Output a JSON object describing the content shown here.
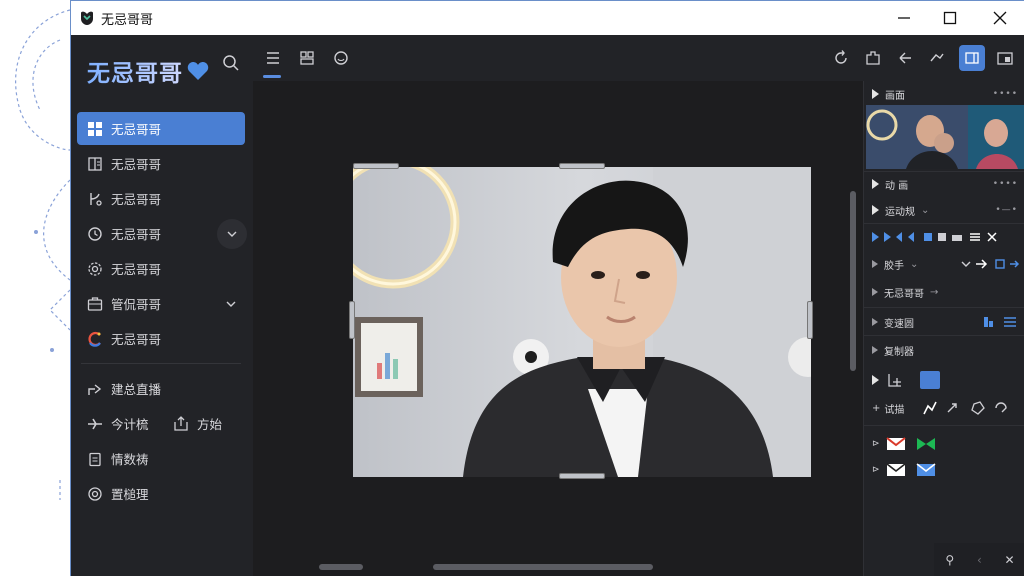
{
  "window": {
    "title": "无忌哥哥",
    "controls": {
      "minimize": "minimize",
      "maximize": "maximize",
      "close": "close"
    }
  },
  "sidebar": {
    "brand": "无忌哥哥",
    "items": [
      {
        "label": "无忌哥哥",
        "icon": "grid-icon",
        "active": true
      },
      {
        "label": "无忌哥哥",
        "icon": "book-icon",
        "active": false
      },
      {
        "label": "无忌哥哥",
        "icon": "branch-icon",
        "active": false
      },
      {
        "label": "无忌哥哥",
        "icon": "clock-icon",
        "active": false,
        "expand": true
      },
      {
        "label": "无忌哥哥",
        "icon": "gear-icon",
        "active": false
      },
      {
        "label": "管侃哥哥",
        "icon": "briefcase-icon",
        "active": false,
        "chevron": true
      },
      {
        "label": "无忌哥哥",
        "icon": "colorful-c-icon",
        "active": false
      }
    ],
    "bottom_items": [
      {
        "label": "建总直播",
        "icon": "share-icon"
      },
      {
        "label": "今计梳",
        "icon": "plane-icon",
        "label2": "方始",
        "icon2": "export-icon"
      },
      {
        "label": "情数祷",
        "icon": "clipboard-icon"
      },
      {
        "label": "置槌理",
        "icon": "settings-icon"
      }
    ]
  },
  "toolbar": {
    "left_icons": [
      "list-icon",
      "layers-icon",
      "sticker-icon"
    ],
    "right_icons": [
      "rotate-icon",
      "puzzle-icon",
      "undo-icon",
      "redo-icon",
      "panel-toggle-icon",
      "window-icon"
    ]
  },
  "right_panel": {
    "section1": "画面",
    "section2": "动 画",
    "section3": "运动规",
    "row_speed": "胶手",
    "row_effect": "无忌哥哥",
    "section4": "变速圆",
    "section5": "复制器",
    "row_add": "试描"
  },
  "colors": {
    "accent": "#4a7fd3",
    "sidebar_bg": "#222327",
    "canvas_bg": "#1d1d1f"
  }
}
